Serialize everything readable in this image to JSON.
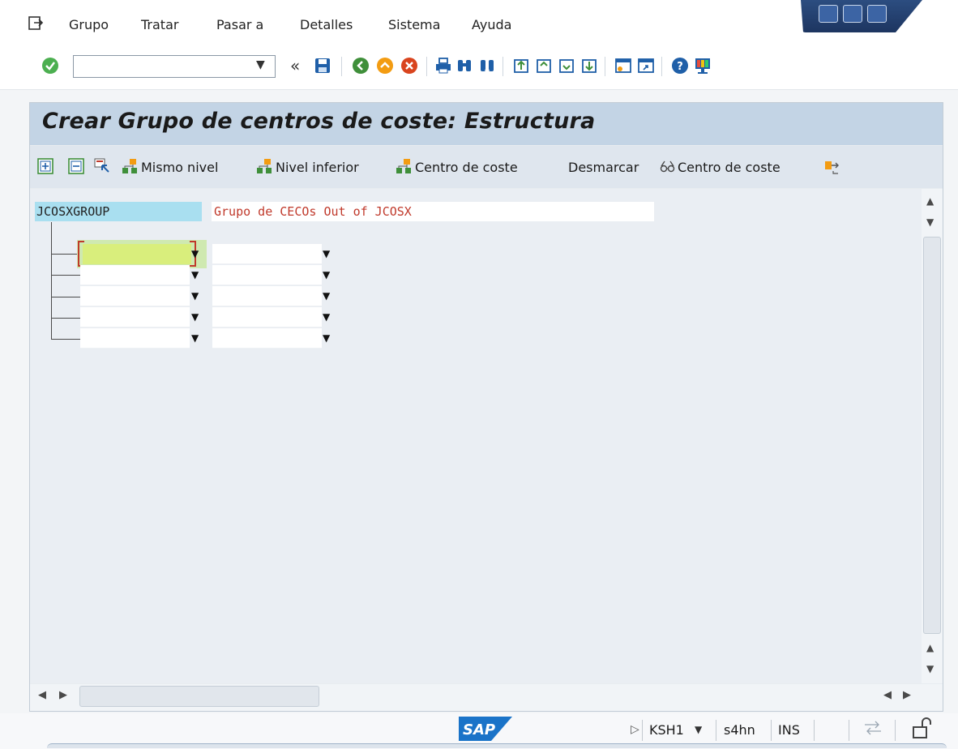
{
  "menu": {
    "items": [
      {
        "label": "Grupo"
      },
      {
        "label": "Tratar"
      },
      {
        "label": "Pasar a"
      },
      {
        "label": "Detalles"
      },
      {
        "label": "Sistema"
      },
      {
        "label": "Ayuda"
      }
    ]
  },
  "toolbar": {
    "command_field_value": "",
    "back_arrows": "«"
  },
  "page": {
    "title": "Crear Grupo de centros de coste: Estructura"
  },
  "app_toolbar": {
    "same_level": "Mismo nivel",
    "lower_level": "Nivel inferior",
    "cost_center": "Centro de coste",
    "unmark": "Desmarcar",
    "cost_center_2": "Centro de coste"
  },
  "tree": {
    "root_key": "JCOSXGROUP",
    "root_description": "Grupo de CECOs Out of JCOSX",
    "rows": [
      {
        "key": "",
        "description": ""
      },
      {
        "key": "",
        "description": ""
      },
      {
        "key": "",
        "description": ""
      },
      {
        "key": "",
        "description": ""
      },
      {
        "key": "",
        "description": ""
      }
    ]
  },
  "status": {
    "transaction": "KSH1",
    "system": "s4hn",
    "mode": "INS",
    "logo_text": "SAP"
  },
  "colors": {
    "accent": "#c3d4e5",
    "root_key_bg": "#a9dff0",
    "focus_cell": "#d9ee7c",
    "description_text": "#c0392b"
  }
}
